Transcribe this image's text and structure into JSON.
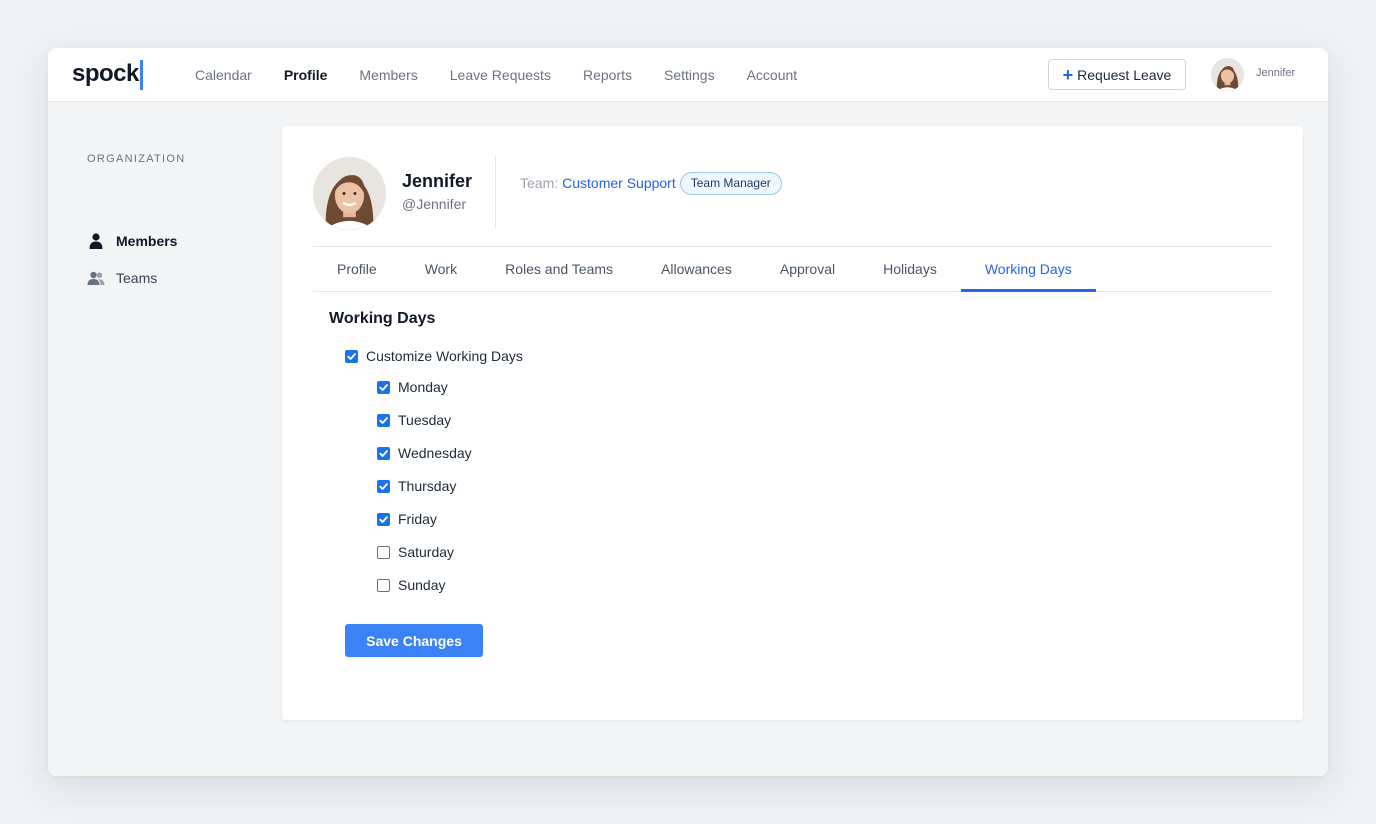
{
  "app": {
    "logo": "spock"
  },
  "nav": {
    "links": [
      "Calendar",
      "Profile",
      "Members",
      "Leave Requests",
      "Reports",
      "Settings",
      "Account"
    ],
    "active": "Profile",
    "request_leave": "Request Leave",
    "current_user": "Jennifer"
  },
  "sidebar": {
    "heading": "ORGANIZATION",
    "items": [
      {
        "label": "Members",
        "icon": "user-icon",
        "active": true
      },
      {
        "label": "Teams",
        "icon": "users-icon",
        "active": false
      }
    ]
  },
  "profile": {
    "name": "Jennifer",
    "handle": "@Jennifer",
    "team_label": "Team:",
    "team": "Customer Support",
    "role_badge": "Team Manager"
  },
  "tabs": {
    "items": [
      "Profile",
      "Work",
      "Roles and Teams",
      "Allowances",
      "Approval",
      "Holidays",
      "Working Days"
    ],
    "active": "Working Days"
  },
  "working_days": {
    "title": "Working Days",
    "customize": {
      "label": "Customize Working Days",
      "checked": true
    },
    "days": [
      {
        "label": "Monday",
        "checked": true
      },
      {
        "label": "Tuesday",
        "checked": true
      },
      {
        "label": "Wednesday",
        "checked": true
      },
      {
        "label": "Thursday",
        "checked": true
      },
      {
        "label": "Friday",
        "checked": true
      },
      {
        "label": "Saturday",
        "checked": false
      },
      {
        "label": "Sunday",
        "checked": false
      }
    ],
    "save_label": "Save Changes"
  },
  "colors": {
    "accent": "#2563eb",
    "button": "#3b82f6",
    "checkbox": "#1a73e8"
  }
}
